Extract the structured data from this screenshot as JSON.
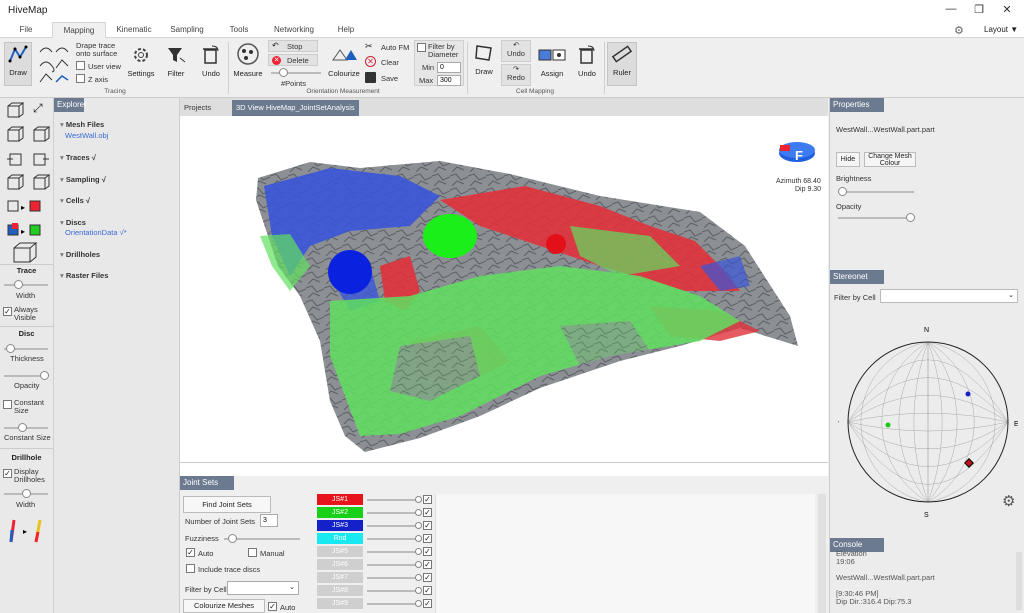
{
  "app": {
    "title": "HiveMap"
  },
  "window": {
    "minimize": "—",
    "maximize": "❐",
    "close": "✕"
  },
  "menu": {
    "tabs": [
      "File",
      "Mapping",
      "Kinematic",
      "Sampling",
      "Tools",
      "Networking",
      "Help"
    ],
    "selected": "Mapping",
    "layout": "Layout ▼"
  },
  "ribbon": {
    "draw": "Draw",
    "drape": "Drape trace onto surface",
    "user_view": "User view",
    "z_axis": "Z axis",
    "settings": "Settings",
    "filter": "Filter",
    "undo": "Undo",
    "tracing_group": "Tracing",
    "measure": "Measure",
    "stop": "Stop",
    "delete": "Delete",
    "points": "#Points",
    "colourize": "Colourize",
    "auto_fm": "Auto FM",
    "clear": "Clear",
    "save": "Save",
    "filter_by_diameter": "Filter by Diameter",
    "min_label": "Min",
    "min_value": "0",
    "max_label": "Max",
    "max_value": "300",
    "orientation_group": "Orientation Measurement",
    "cell_draw": "Draw",
    "cell_undo": "Undo",
    "cell_redo": "Redo",
    "assign": "Assign",
    "cell_undo2": "Undo",
    "cell_group": "Cell Mapping",
    "ruler": "Ruler"
  },
  "left": {
    "trace": "Trace",
    "width": "Width",
    "always_visible": "Always Visible",
    "disc": "Disc",
    "thickness": "Thickness",
    "opacity": "Opacity",
    "constant_size": "Constant Size",
    "constant_size2": "Constant Size",
    "drillhole": "Drillhole",
    "display_drillholes": "Display Drillholes",
    "dh_width": "Width"
  },
  "explorer": {
    "title": "Explorer",
    "mesh_files": "Mesh Files",
    "mesh_item": "WestWall.obj",
    "traces": "Traces √",
    "sampling": "Sampling √",
    "cells": "Cells √",
    "discs": "Discs",
    "discs_item": "OrientationData √*",
    "drillholes": "Drillholes",
    "raster": "Raster Files"
  },
  "view": {
    "tabs": [
      "Projects",
      "3D View HiveMap_JointSetAnalysis"
    ],
    "azimuth": "Azimuth 68.40",
    "dip": "Dip 9.30",
    "compass_letter": "F"
  },
  "joint_sets": {
    "title": "Joint Sets",
    "find": "Find Joint Sets",
    "number_label": "Number of Joint Sets",
    "number_value": "3",
    "fuzziness": "Fuzziness",
    "auto": "Auto",
    "manual": "Manual",
    "include_trace": "Include trace discs",
    "filter_by_cell": "Filter by Cell",
    "colourize_meshes": "Colourize Meshes",
    "auto2": "Auto",
    "sets": [
      {
        "label": "JS#1",
        "color": "#e8141c"
      },
      {
        "label": "JS#2",
        "color": "#18d018"
      },
      {
        "label": "JS#3",
        "color": "#1421c8"
      },
      {
        "label": "Rnd",
        "color": "#18e8f0"
      },
      {
        "label": "JS#5",
        "color": "#cfcfcf"
      },
      {
        "label": "JS#6",
        "color": "#cfcfcf"
      },
      {
        "label": "JS#7",
        "color": "#cfcfcf"
      },
      {
        "label": "JS#8",
        "color": "#cfcfcf"
      },
      {
        "label": "JS#9",
        "color": "#cfcfcf"
      }
    ]
  },
  "properties": {
    "title": "Properties",
    "object_name": "WestWall...WestWall.part.part",
    "hide": "Hide",
    "change_colour": "Change Mesh Colour",
    "brightness": "Brightness",
    "opacity": "Opacity"
  },
  "stereonet": {
    "title": "Stereonet",
    "filter_label": "Filter by Cell",
    "n": "N",
    "e": "E",
    "s": "S",
    "w": "W"
  },
  "console": {
    "title": "Console",
    "lines": [
      "Elevation",
      "19:06",
      "",
      "WestWall...WestWall.part.part",
      "",
      "[9:30:46 PM]",
      "Dip Dir.:316.4 Dip:75.3"
    ]
  }
}
